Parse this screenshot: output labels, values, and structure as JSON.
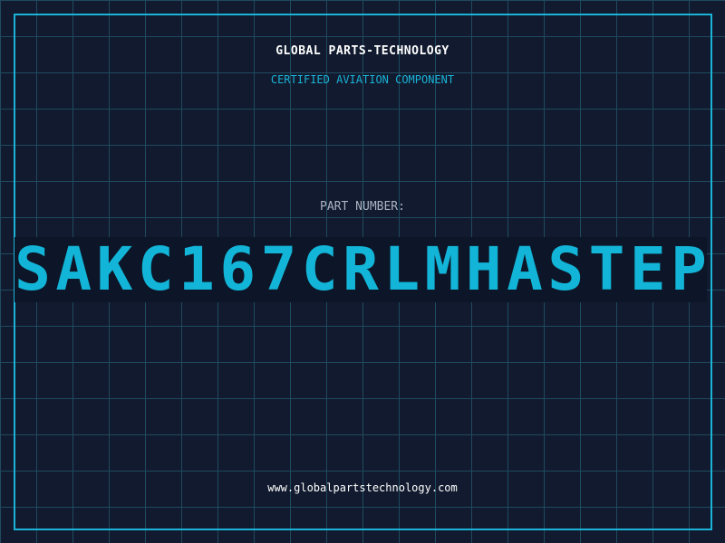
{
  "header": {
    "company": "GLOBAL PARTS-TECHNOLOGY",
    "subtitle": "CERTIFIED AVIATION COMPONENT"
  },
  "part": {
    "label": "PART NUMBER:",
    "number": "SAKC167CRLMHASTEP"
  },
  "footer": {
    "website": "www.globalpartstechnology.com"
  },
  "colors": {
    "background": "#111a2e",
    "grid": "#1f4a5e",
    "accent": "#1bb3d8",
    "part_number": "#12b5d8"
  }
}
